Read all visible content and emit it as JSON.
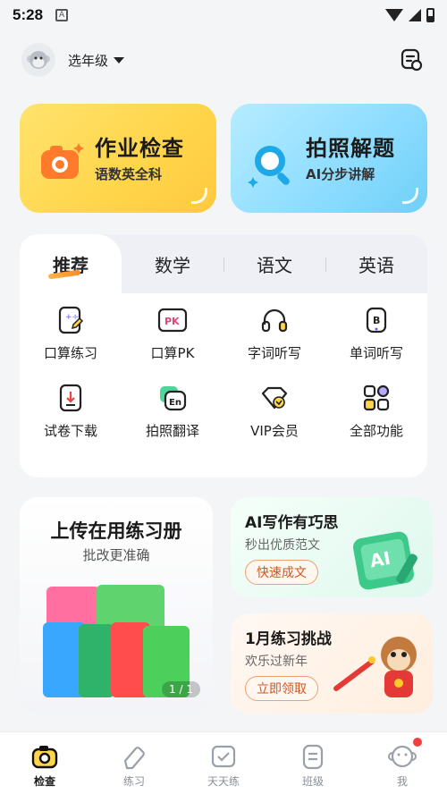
{
  "status": {
    "time": "5:28",
    "app_badge": "A"
  },
  "header": {
    "grade_selector": "选年级"
  },
  "hero_cards": [
    {
      "title": "作业检查",
      "subtitle": "语数英全科"
    },
    {
      "title": "拍照解题",
      "subtitle": "AI分步讲解"
    }
  ],
  "tabs": [
    {
      "label": "推荐"
    },
    {
      "label": "数学"
    },
    {
      "label": "语文"
    },
    {
      "label": "英语"
    }
  ],
  "features": [
    {
      "label": "口算练习",
      "icon": "calc-sheet-icon"
    },
    {
      "label": "口算PK",
      "icon": "pk-icon",
      "icon_text": "PK"
    },
    {
      "label": "字词听写",
      "icon": "headphones-icon"
    },
    {
      "label": "单词听写",
      "icon": "word-card-icon",
      "icon_text": "B"
    },
    {
      "label": "试卷下载",
      "icon": "download-paper-icon"
    },
    {
      "label": "拍照翻译",
      "icon": "translate-icon",
      "icon_text": "En"
    },
    {
      "label": "VIP会员",
      "icon": "vip-icon"
    },
    {
      "label": "全部功能",
      "icon": "grid-apps-icon"
    }
  ],
  "upload_card": {
    "title": "上传在用练习册",
    "subtitle": "批改更准确",
    "pager": "1 / 1"
  },
  "promos": [
    {
      "title": "AI写作有巧思",
      "subtitle": "秒出优质范文",
      "button": "快速成文"
    },
    {
      "title": "1月练习挑战",
      "subtitle": "欢乐过新年",
      "button": "立即领取"
    }
  ],
  "bottom_nav": [
    {
      "label": "检查",
      "active": true
    },
    {
      "label": "练习",
      "active": false
    },
    {
      "label": "天天练",
      "active": false
    },
    {
      "label": "班级",
      "active": false
    },
    {
      "label": "我",
      "active": false
    }
  ],
  "colors": {
    "accent_yellow": "#ffd54a",
    "accent_blue": "#8cdcff",
    "accent_orange": "#ff8a2a"
  }
}
